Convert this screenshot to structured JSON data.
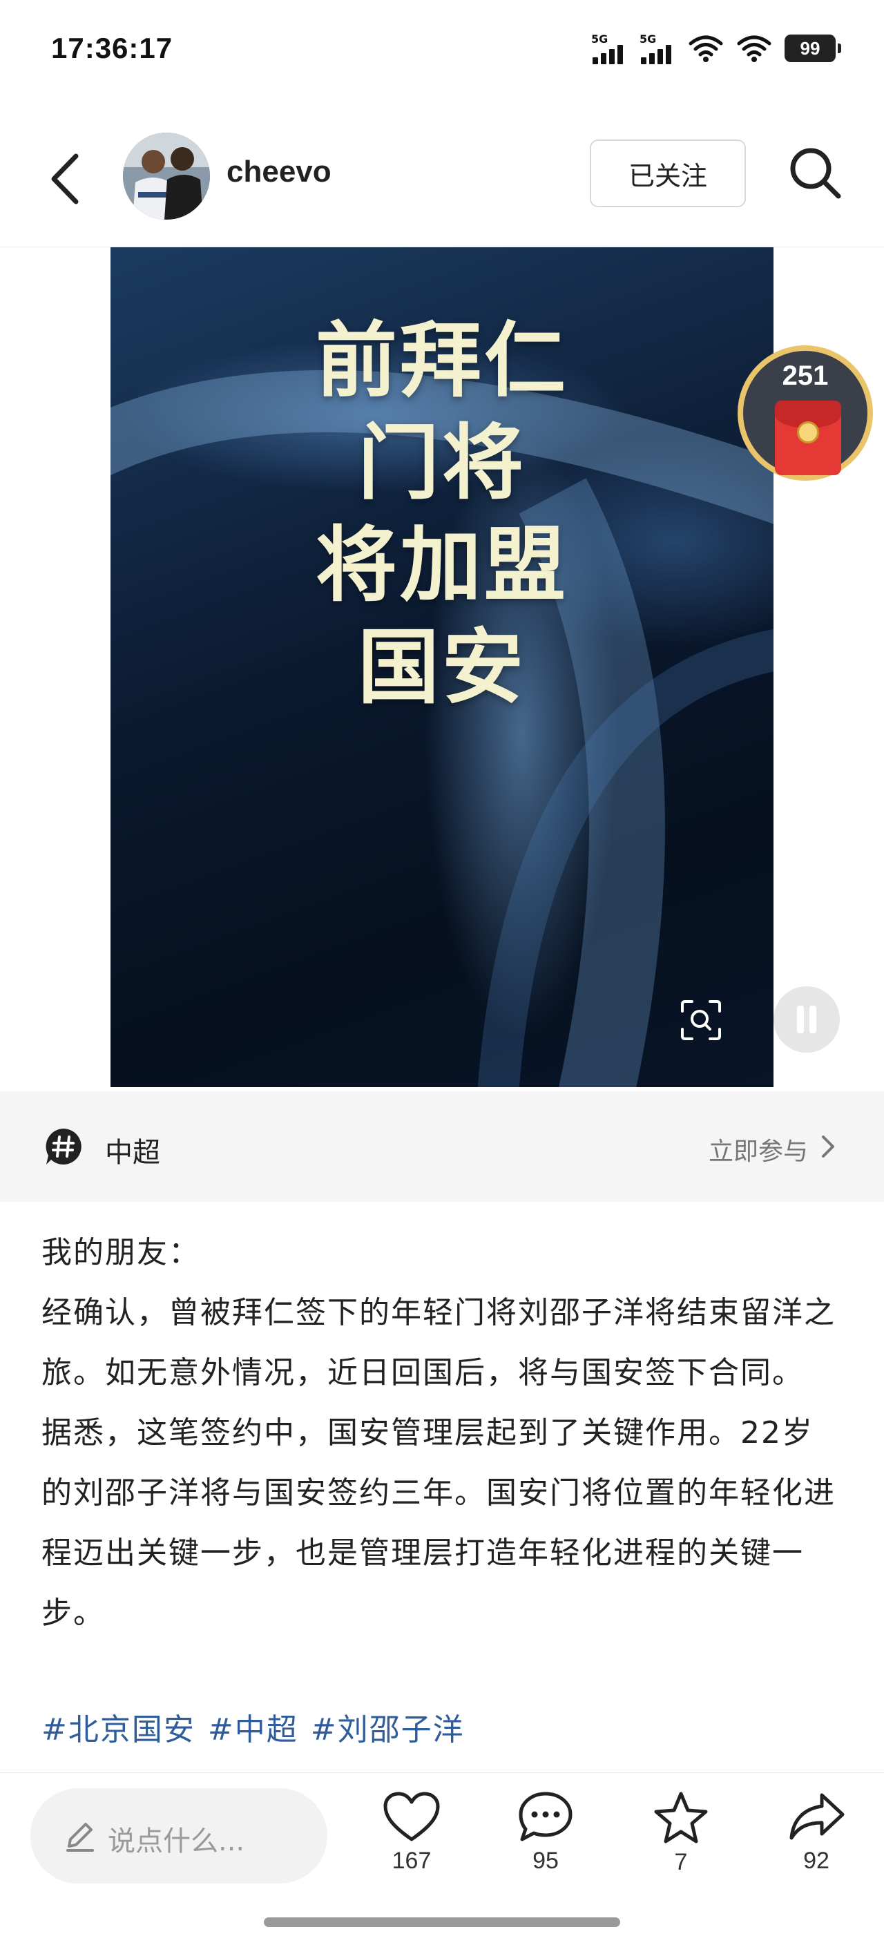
{
  "status_bar": {
    "time": "17:36:17",
    "sim1": "5G",
    "sim2": "5G",
    "battery": "99"
  },
  "header": {
    "username": "cheevo",
    "follow_label": "已关注"
  },
  "media": {
    "title_lines": [
      "前拜仁",
      "门将",
      "将加盟",
      "国安"
    ]
  },
  "red_packet": {
    "count": "251"
  },
  "topic": {
    "name": "中超",
    "join_label": "立即参与"
  },
  "post": {
    "paragraphs": [
      "我的朋友：",
      "经确认，曾被拜仁签下的年轻门将刘邵子洋将结束留洋之旅。如无意外情况，近日回国后，将与国安签下合同。",
      "据悉，这笔签约中，国安管理层起到了关键作用。22岁的刘邵子洋将与国安签约三年。国安门将位置的年轻化进程迈出关键一步，也是管理层打造年轻化进程的关键一步。"
    ],
    "hashtags": [
      "#北京国安",
      "#中超",
      "#刘邵子洋"
    ]
  },
  "bottom_bar": {
    "comment_placeholder": "说点什么...",
    "likes": "167",
    "comments": "95",
    "favorites": "7",
    "shares": "92"
  }
}
